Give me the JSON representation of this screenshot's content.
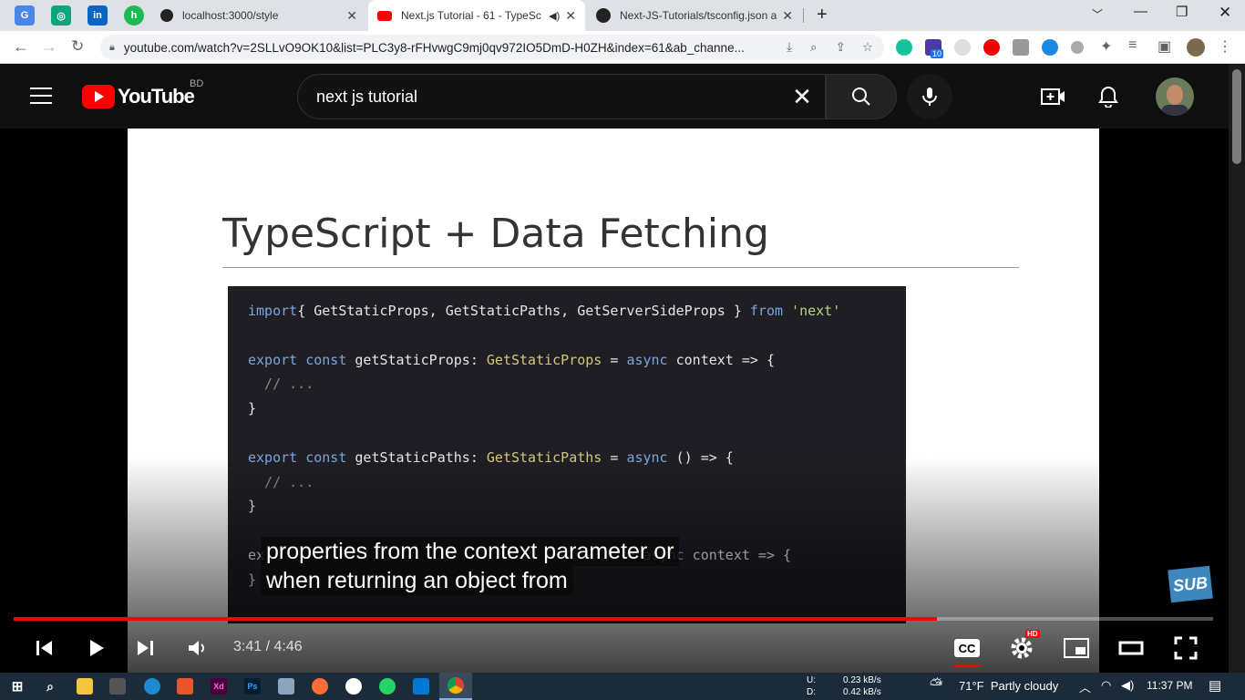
{
  "browser": {
    "tabs": [
      {
        "title": "localhost:3000/style",
        "icon": "vercel-icon"
      },
      {
        "title": "Next.js Tutorial - 61 - TypeSc",
        "icon": "youtube-icon",
        "active": true
      },
      {
        "title": "Next-JS-Tutorials/tsconfig.json at",
        "icon": "github-icon"
      }
    ],
    "new_tab": "+",
    "url": "youtube.com/watch?v=2SLLvO9OK10&list=PLC3y8-rFHvwgC9mj0qv972IO5DmD-H0ZH&index=61&ab_channe...",
    "extension_badge": "10"
  },
  "youtube": {
    "logo_text": "YouTube",
    "country": "BD",
    "search_value": "next js tutorial"
  },
  "slide": {
    "title": "TypeScript + Data Fetching",
    "code": [
      [
        [
          "kw",
          "import"
        ],
        [
          "",
          "{ GetStaticProps, GetStaticPaths, GetServerSideProps } "
        ],
        [
          "kw",
          "from"
        ],
        [
          "st",
          " 'next'"
        ]
      ],
      [],
      [
        [
          "kw",
          "export const "
        ],
        [
          "",
          "getStaticProps: "
        ],
        [
          "ty",
          "GetStaticProps"
        ],
        [
          "",
          " = "
        ],
        [
          "kw",
          "async"
        ],
        [
          "",
          " context => {"
        ]
      ],
      [
        [
          "cm",
          "  // ..."
        ]
      ],
      [
        [
          "",
          "}"
        ]
      ],
      [],
      [
        [
          "kw",
          "export const "
        ],
        [
          "",
          "getStaticPaths: "
        ],
        [
          "ty",
          "GetStaticPaths"
        ],
        [
          "",
          " = "
        ],
        [
          "kw",
          "async"
        ],
        [
          "",
          " () => {"
        ]
      ],
      [
        [
          "cm",
          "  // ..."
        ]
      ],
      [
        [
          "",
          "}"
        ]
      ],
      [],
      [
        [
          "",
          "ex"
        ],
        [
          "",
          ""
        ],
        [
          "",
          "                                            = "
        ],
        [
          "kw",
          "async"
        ],
        [
          "",
          " context => {"
        ]
      ],
      [
        [
          "",
          "}"
        ]
      ]
    ]
  },
  "captions": {
    "line1": "properties from the context parameter or",
    "line2": "when returning an object from"
  },
  "sub_badge": "SUB",
  "player": {
    "time": "3:41 / 4:46",
    "progress_fraction": 0.77,
    "hd_badge": "HD"
  },
  "taskbar": {
    "net_up_label": "U:",
    "net_up": "0.23 kB/s",
    "net_down_label": "D:",
    "net_down": "0.42 kB/s",
    "weather": "71°F  Partly cloudy",
    "clock": "11:37 PM"
  }
}
